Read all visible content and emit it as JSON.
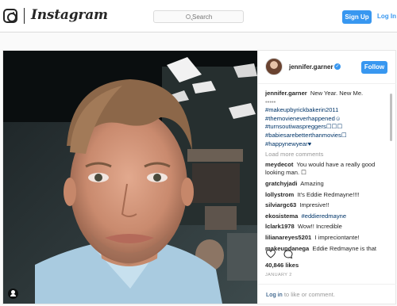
{
  "header": {
    "brand": "Instagram",
    "search_placeholder": "Search",
    "signup_label": "Sign Up",
    "login_label": "Log In"
  },
  "post": {
    "author": "jennifer.garner",
    "follow_label": "Follow",
    "caption": {
      "user": "jennifer.garner",
      "text": "New Year. New Me.",
      "dots": "•••••",
      "hashtags": [
        "#makeupbyrickbakerin2011",
        "#themovieneverhappened☺",
        "#turnsoutiwaspreggers☐☐☐",
        "#babiesarebetterthanmovies☐",
        "#happynewyear♥"
      ]
    },
    "load_more": "Load more comments",
    "comments": [
      {
        "user": "meydecot",
        "text": "You would have a really good looking man. ☐"
      },
      {
        "user": "gratchyjadi",
        "text": "Amazing"
      },
      {
        "user": "lollystrom",
        "text": "It's Eddie Redmayne!!!!"
      },
      {
        "user": "silviargc63",
        "text": "Impresive!!"
      },
      {
        "user": "ekosistema",
        "text": "#eddieredmayne"
      },
      {
        "user": "lclark1978",
        "text": "Wow!! Incredible"
      },
      {
        "user": "lilianareyes5201",
        "text": "I impreciontante!"
      },
      {
        "user": "makeupdanega",
        "text": "Eddie Redmayne is that"
      }
    ],
    "likes": "40,846 likes",
    "date": "JANUARY 2",
    "login_prompt": {
      "link": "Log in",
      "rest": " to like or comment."
    }
  },
  "colors": {
    "accent": "#3897f0",
    "link": "#003569",
    "muted": "#999999"
  },
  "icons": [
    "instagram-logo-icon",
    "search-icon",
    "verified-icon",
    "heart-icon",
    "comment-icon",
    "user-tag-icon"
  ]
}
